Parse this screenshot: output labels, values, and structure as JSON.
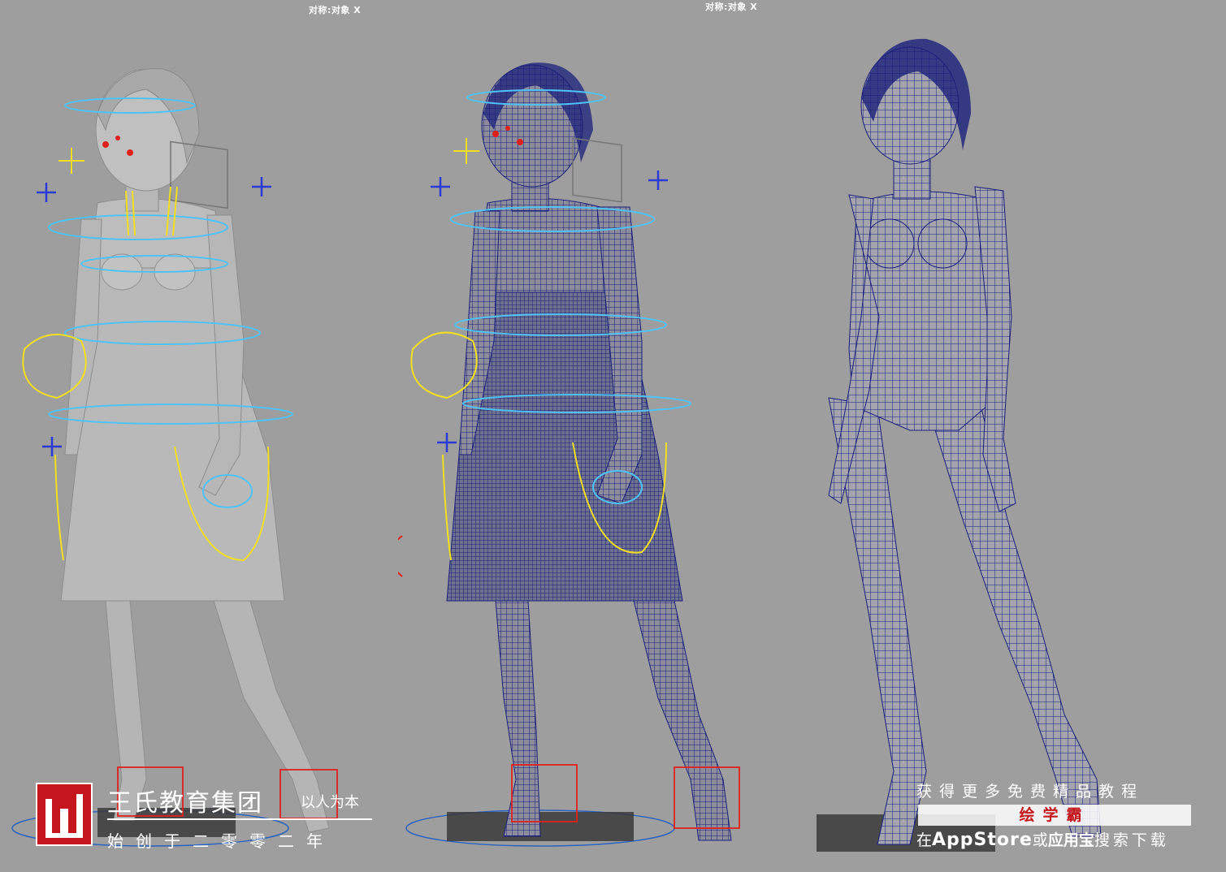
{
  "viewports": {
    "left_label": "对称:对象 X",
    "mid_label": "对称:对象 X"
  },
  "logo": {
    "mark": "W",
    "name": "王氏教育集团",
    "slogan": "以人为本",
    "since": "始创于二零零二年"
  },
  "promo": {
    "line1": "获得更多免费精品教程",
    "app_name": "绘学霸",
    "line3_prefix": "在",
    "line3_store": "AppStore",
    "line3_or": "或",
    "line3_market": "应用宝",
    "line3_suffix": "搜索下载"
  },
  "colors": {
    "background": "#9e9e9e",
    "body_shaded": "#b9b9b9",
    "wireframe": "#1a1f7a",
    "ctrl_cyan": "#4fc3f7",
    "ctrl_yellow": "#f2e020",
    "ctrl_red": "#e0201c",
    "ctrl_blue": "#2b3ad6",
    "brand_red": "#c4161c"
  }
}
